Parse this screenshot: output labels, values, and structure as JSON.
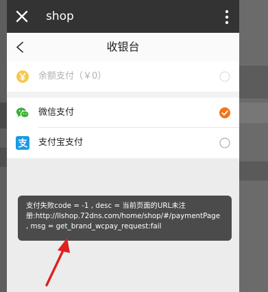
{
  "topbar": {
    "title": "shop",
    "close_icon": "close-icon",
    "more_icon": "more-vertical-icon"
  },
  "navbar": {
    "title": "收银台",
    "back_icon": "chevron-left-icon"
  },
  "payment_methods": [
    {
      "label": "余额支付（￥0）",
      "icon": "yuan-coin-icon",
      "selected": false,
      "disabled": true
    },
    {
      "label": "微信支付",
      "icon": "wechat-icon",
      "selected": true,
      "disabled": false
    },
    {
      "label": "支付宝支付",
      "icon": "alipay-icon",
      "selected": false,
      "disabled": false
    }
  ],
  "toast": {
    "line1": "支付失败code = -1 , desc = 当前页面的URL未注",
    "line2": "册:http://llshop.72dns.com/home/shop/#/paymentPage",
    "line3": ", msg = get_brand_wcpay_request:fail"
  },
  "colors": {
    "topbar": "#333333",
    "selected": "#f5721b",
    "wechat": "#3cb034",
    "alipay": "#1a9be8",
    "coin": "#f5c84a",
    "arrow": "#e02020"
  }
}
